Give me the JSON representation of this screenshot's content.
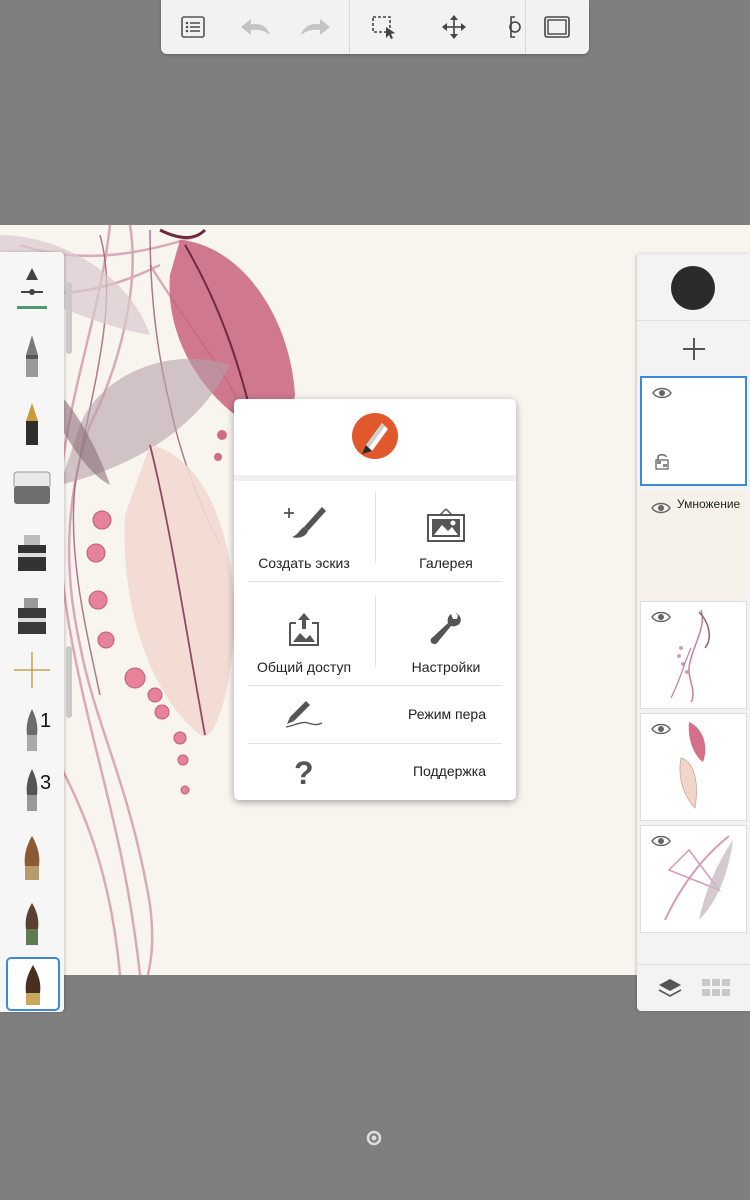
{
  "toolbar": {
    "buttons": [
      "list-icon",
      "undo-icon",
      "redo-icon",
      "selection-icon",
      "move-icon",
      "symmetry-icon",
      "fullscreen-icon"
    ]
  },
  "brush_palette": {
    "numbered": [
      {
        "label": "1"
      },
      {
        "label": "3"
      }
    ]
  },
  "layers": {
    "current_color": "#2b2b2b",
    "blend_mode": "Умножение"
  },
  "menu": {
    "create_sketch": "Создать эскиз",
    "gallery": "Галерея",
    "share": "Общий доступ",
    "settings": "Настройки",
    "pen_mode": "Режим пера",
    "support": "Поддержка"
  },
  "colors": {
    "accent": "#3b8ad9",
    "logo": "#e1582d",
    "background": "#7f7f7f"
  }
}
